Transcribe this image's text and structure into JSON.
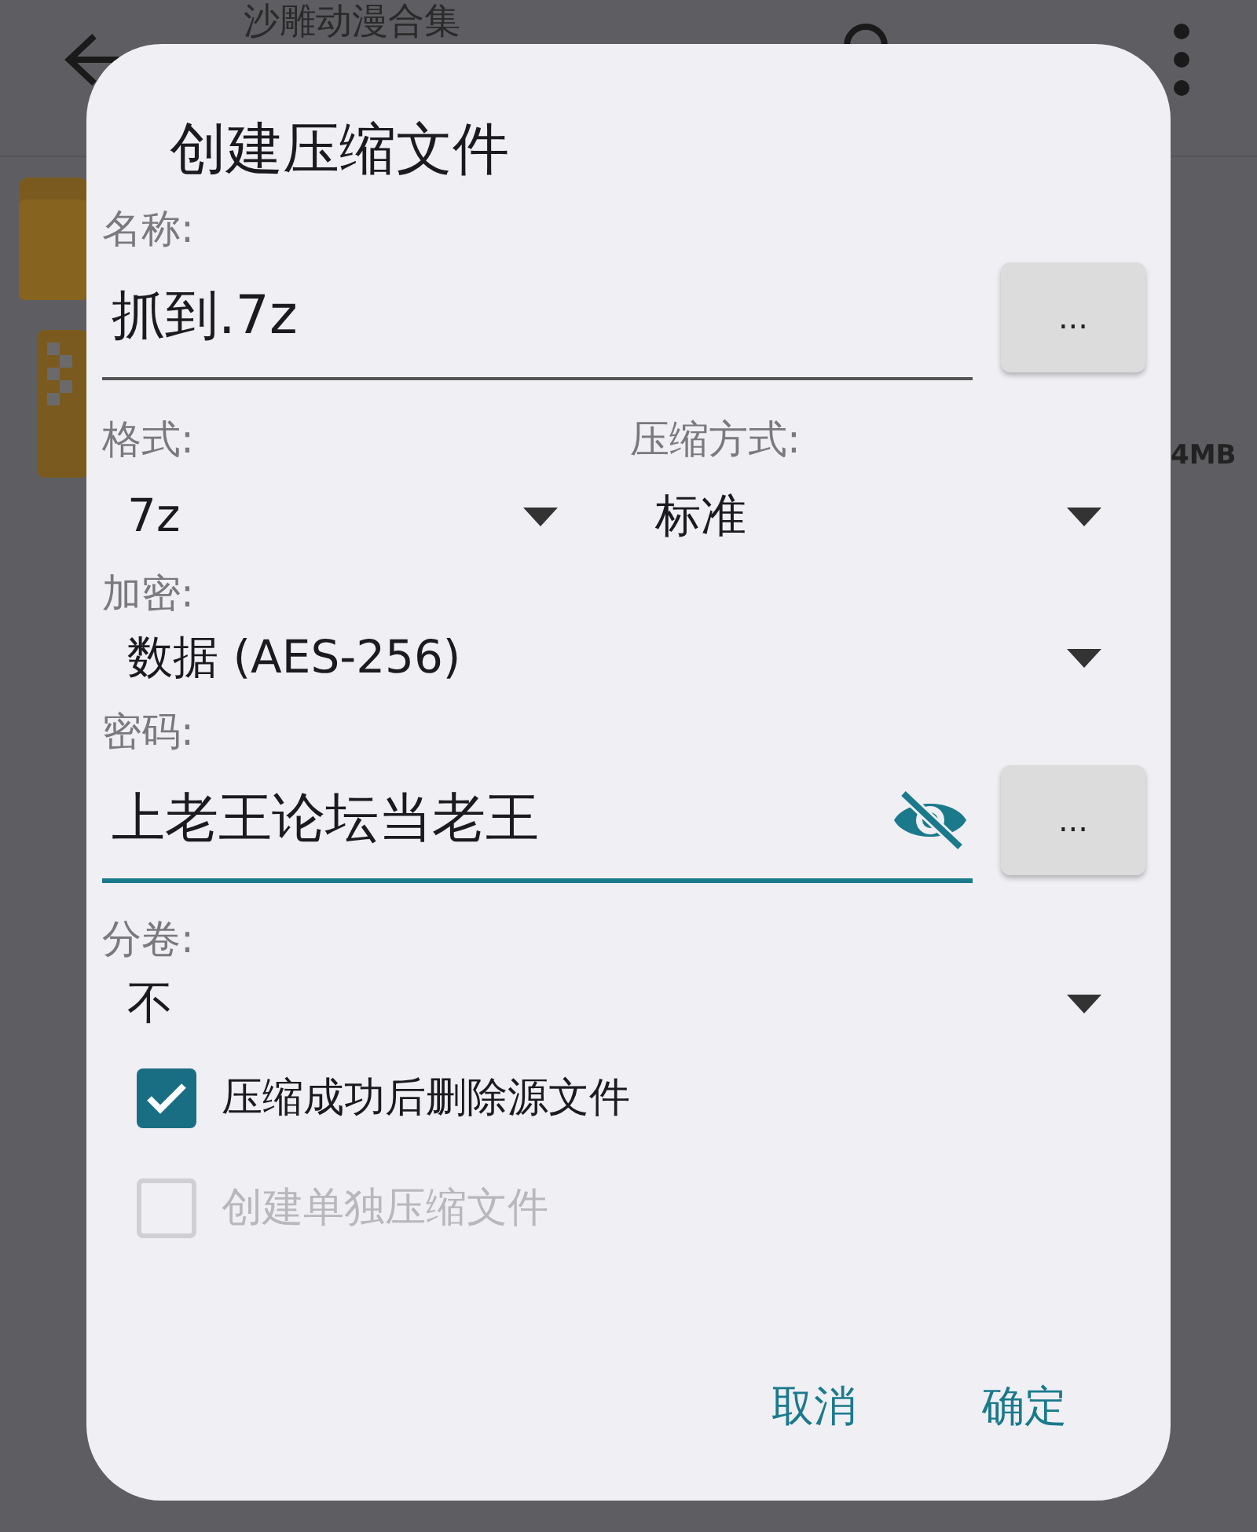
{
  "background": {
    "title": "沙雕动漫合集",
    "size": "4MB"
  },
  "dialog": {
    "title": "创建压缩文件",
    "name": {
      "label": "名称:",
      "value": "抓到.7z",
      "focused": false,
      "button": "..."
    },
    "format": {
      "label": "格式:",
      "value": "7z"
    },
    "method": {
      "label": "压缩方式:",
      "value": "标准"
    },
    "encryption": {
      "label": "加密:",
      "value": "数据 (AES-256)"
    },
    "password": {
      "label": "密码:",
      "value": "上老王论坛当老王",
      "focused": true,
      "button": "..."
    },
    "split": {
      "label": "分卷:",
      "value": "不"
    },
    "options": [
      {
        "label": "压缩成功后删除源文件",
        "checked": true,
        "disabled": false
      },
      {
        "label": "创建单独压缩文件",
        "checked": false,
        "disabled": true
      }
    ],
    "buttons": [
      "取消",
      "确定"
    ]
  }
}
